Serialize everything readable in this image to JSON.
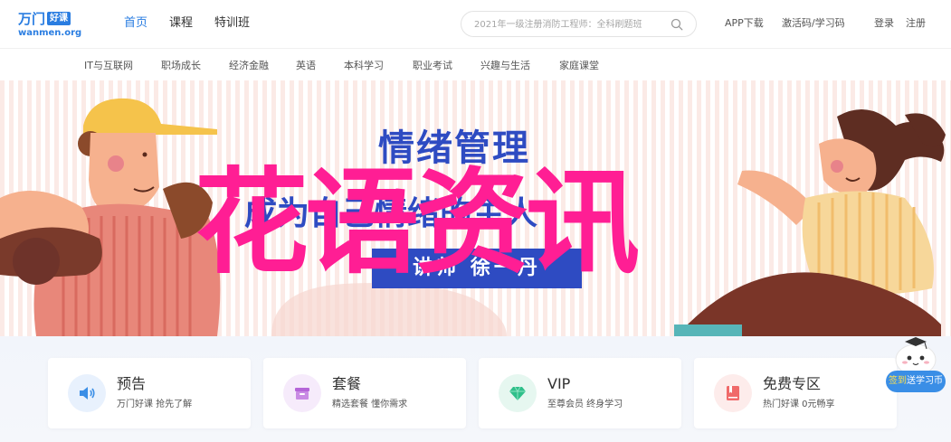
{
  "logo": {
    "main": "万门",
    "tag": "好课",
    "sub": "wanmen.org"
  },
  "nav": {
    "items": [
      {
        "label": "首页",
        "active": true
      },
      {
        "label": "课程",
        "active": false
      },
      {
        "label": "特训班",
        "active": false
      }
    ]
  },
  "search": {
    "placeholder": "2021年一级注册消防工程师：全科刷题班",
    "icon": "search-icon"
  },
  "top_links": {
    "app_download": "APP下载",
    "activation": "激活码/学习码",
    "login": "登录",
    "register": "注册"
  },
  "categories": [
    "IT与互联网",
    "职场成长",
    "经济金融",
    "英语",
    "本科学习",
    "职业考试",
    "兴趣与生活",
    "家庭课堂"
  ],
  "banner": {
    "title": "情绪管理",
    "subtitle": "成为自己情绪的主人",
    "speaker": "讲师  徐一丹",
    "overlay": "花语资讯"
  },
  "cards": [
    {
      "title": "预告",
      "desc": "万门好课 抢先了解",
      "icon": "speaker-icon",
      "color": "#3a8ee6",
      "bg": "#e8f1fd"
    },
    {
      "title": "套餐",
      "desc": "精选套餐 懂你需求",
      "icon": "package-icon",
      "color": "#b565d8",
      "bg": "#f6ebfb"
    },
    {
      "title": "VIP",
      "desc": "至尊会员 终身学习",
      "icon": "diamond-icon",
      "color": "#2fbf8a",
      "bg": "#e6f7f0"
    },
    {
      "title": "免费专区",
      "desc": "热门好课 0元畅享",
      "icon": "book-icon",
      "color": "#f06a6a",
      "bg": "#fdeceb"
    }
  ],
  "mascot": {
    "highlight": "签到",
    "label": "送学习币"
  },
  "colors": {
    "brand": "#2a7de1",
    "banner_blue": "#2e4bc2",
    "overlay_pink": "#ff1e94"
  }
}
